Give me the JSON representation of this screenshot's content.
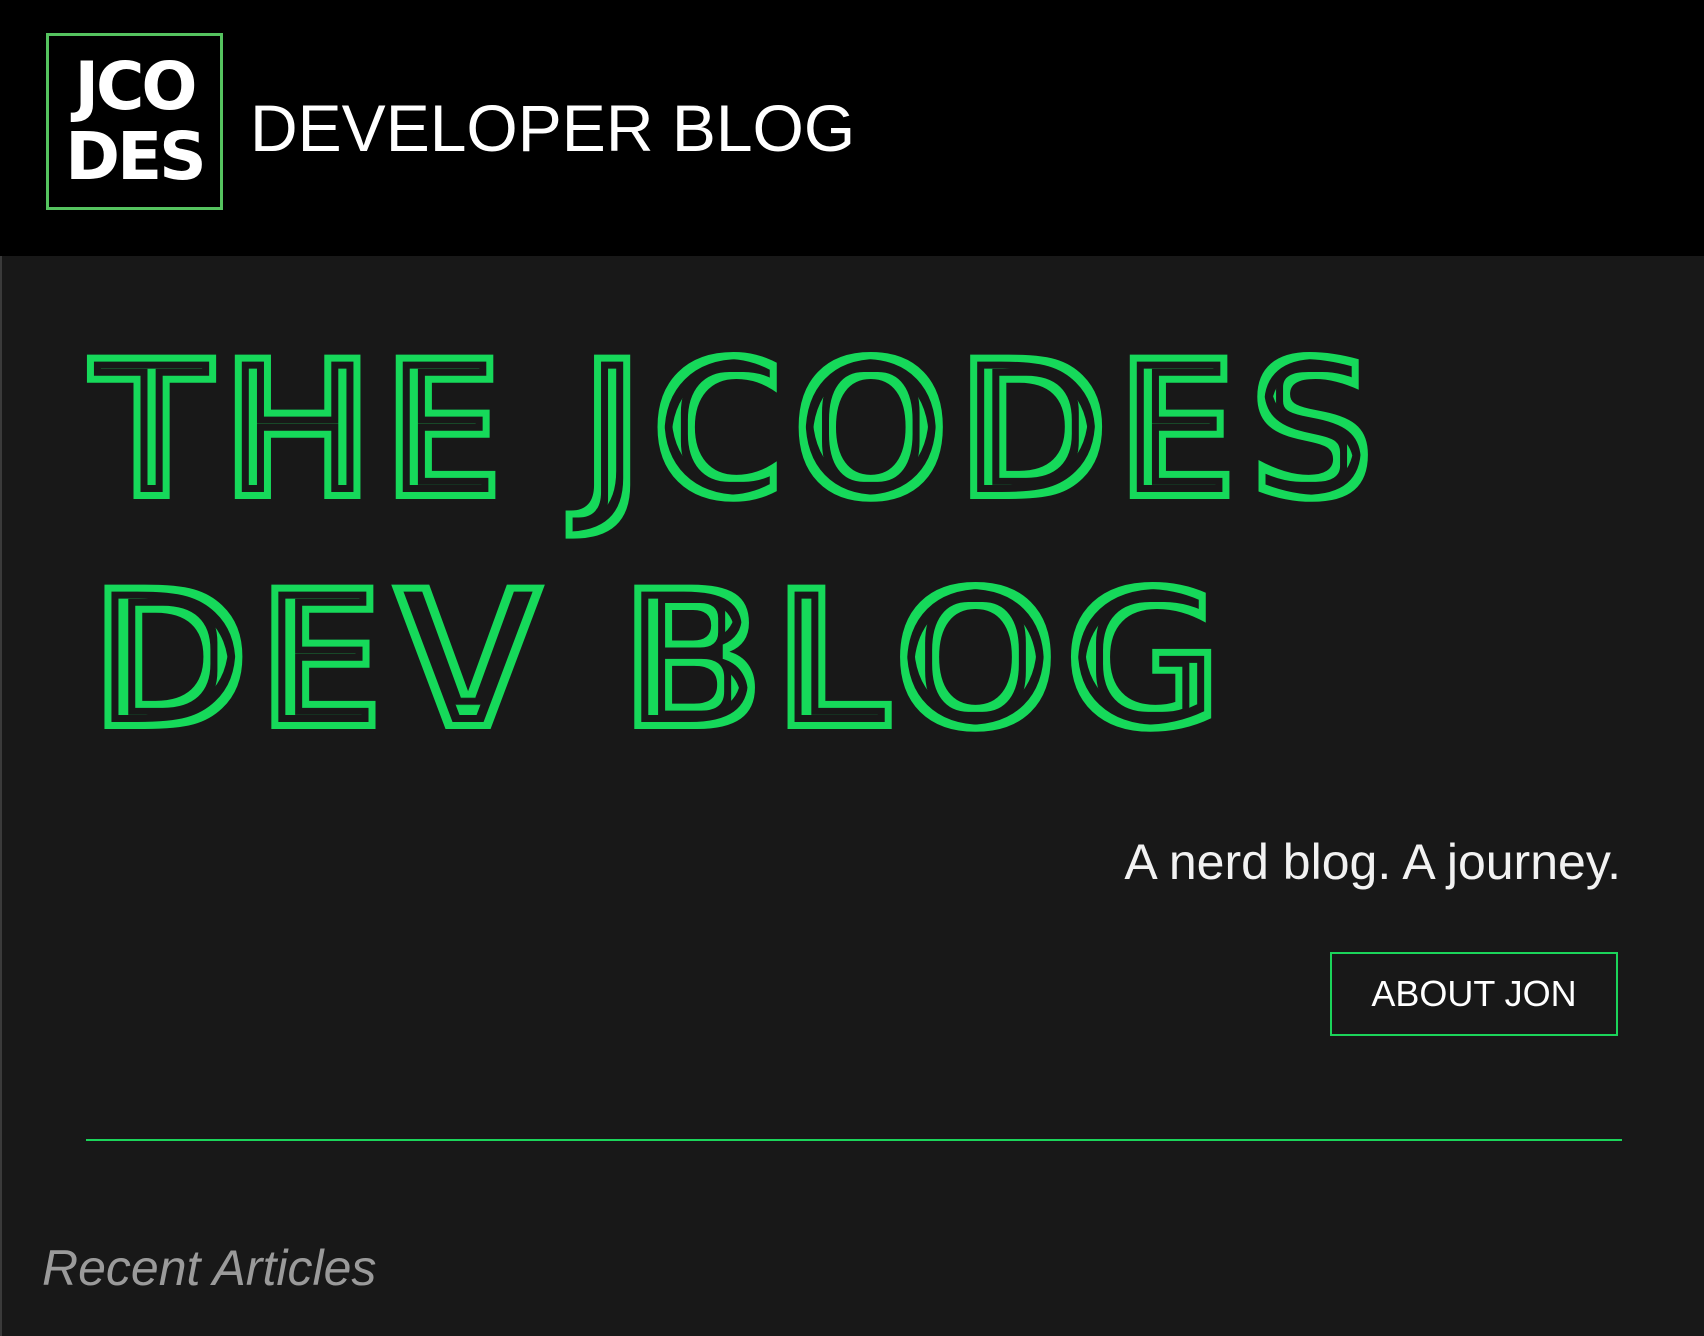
{
  "header": {
    "logo": {
      "line1": "JCO",
      "line2": "DES"
    },
    "site_name": "DEVELOPER BLOG"
  },
  "hero": {
    "title_line1": "THE JCODES",
    "title_line2": "DEV BLOG",
    "tagline": "A nerd blog. A journey.",
    "about_button": "ABOUT JON"
  },
  "sections": {
    "recent_heading": "Recent Articles"
  },
  "colors": {
    "accent_green": "#1bd45a",
    "logo_border": "#55c35f",
    "header_bg": "#000000",
    "page_bg": "#181818",
    "muted_text": "#9a9a9a"
  }
}
